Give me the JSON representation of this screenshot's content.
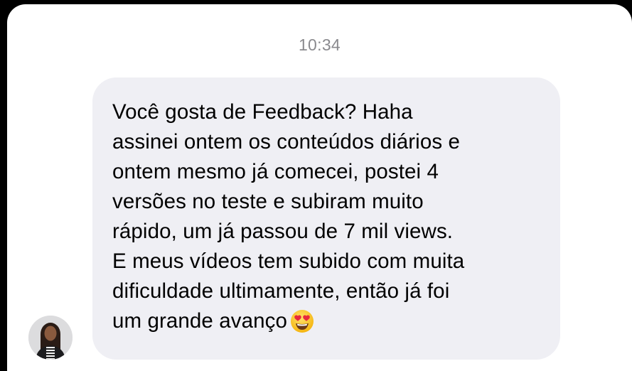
{
  "conversation": {
    "timestamp": "10:34",
    "message": {
      "text": "Você gosta de Feedback? Haha\nassinei ontem os conteúdos diários e\nontem mesmo já comecei, postei 4\nversões no teste e subiram muito\nrápido, um já passou de 7 mil views.\nE meus vídeos tem subido com muita\ndificuldade ultimamente, então já foi\num grande avanço",
      "emoji": "heart-eyes-emoji-icon",
      "bubble_color": "#efeff4"
    },
    "sender_avatar": "avatar"
  }
}
